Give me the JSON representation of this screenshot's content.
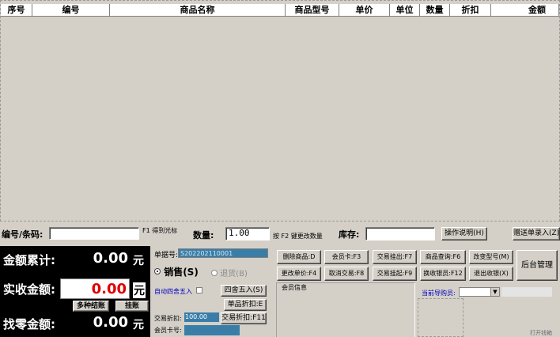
{
  "table": {
    "columns": [
      "序号",
      "编号",
      "商品名称",
      "商品型号",
      "单价",
      "单位",
      "数量",
      "折扣",
      "金额"
    ]
  },
  "input_row": {
    "barcode_label": "编号/条码:",
    "barcode_value": "",
    "f1_hint": "F1 得到光标",
    "qty_label": "数量:",
    "qty_value": "1.00",
    "f2_hint": "按 F2 键更改数量",
    "stock_label": "库存:",
    "stock_value": "",
    "help_button": "操作说明(H)",
    "gift_button": "赠送单录入(Z)"
  },
  "totals": {
    "accum_label": "金额累计:",
    "accum_value": "0.00",
    "paid_label": "实收金额:",
    "paid_value": "0.00",
    "change_label": "找零金额:",
    "change_value": "0.00",
    "currency": "元",
    "multi_pay_button": "多种结账",
    "hang_button": "挂账"
  },
  "middle": {
    "order_no_label": "单据号:",
    "order_no_value": "S202202110001",
    "sale_radio": "销售(S)",
    "return_radio": "退货(B)",
    "auto_round_label": "自动四舍五入",
    "round_button": "四舍五入(S)",
    "item_discount_button": "单品折扣:E",
    "trade_discount_label": "交易折扣:",
    "trade_discount_value": "100.00",
    "trade_discount_button": "交易折扣:F11",
    "member_card_label": "会员卡号:",
    "member_card_value": ""
  },
  "func_buttons": {
    "row1": [
      "删除商品:D",
      "会员卡:F3",
      "交易挂出:F7",
      "商品查询:F6",
      "改变型号(M)"
    ],
    "row2": [
      "更改单价:F4",
      "取消交易:F8",
      "交易挂起:F9",
      "换收银员:F12",
      "退出收银(X)"
    ],
    "backend": "后台管理"
  },
  "member_info_label": "会员信息",
  "guide_label": "当前导购员:",
  "guide_value": "",
  "status_hint": "打开钱箱"
}
